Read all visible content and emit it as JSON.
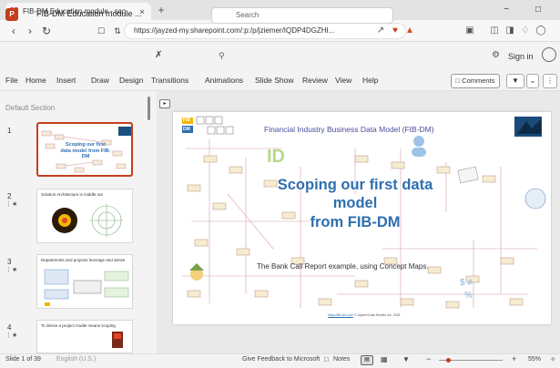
{
  "browser": {
    "tab_title": "FIB-DM Education module - sco",
    "tab_close": "×",
    "new_tab": "+",
    "minimize": "−",
    "maximize": "□",
    "url": "https://jayzed-my.sharepoint.com/:p:/p/jziemer/IQDP4DGZHI..."
  },
  "office": {
    "app_letter": "P",
    "doc_title": "FIB-DM Education module ...",
    "search_placeholder": "Search",
    "sign_in": "Sign in"
  },
  "menu": {
    "items": [
      "File",
      "Home",
      "Insert",
      "Draw",
      "Design",
      "Transitions",
      "Animations",
      "Slide Show",
      "Review",
      "View",
      "Help"
    ],
    "comments": "Comments"
  },
  "slides_panel": {
    "section": "Default Section",
    "thumbs": [
      {
        "num": "1",
        "text": "Scoping our first data model from FIB-DM"
      },
      {
        "num": "2",
        "text": "Solution Architecture is middle out"
      },
      {
        "num": "3",
        "text": "Departments and projects leverage and derive"
      },
      {
        "num": "4",
        "text": "To derive a project model means scoping"
      }
    ]
  },
  "slide": {
    "header": "Financial Industry Business Data Model (FIB-DM)",
    "id_mark": "ID",
    "title_line1": "Scoping our first data",
    "title_line2": "model",
    "title_line3": "from FIB-DM",
    "subtitle": "The Bank Call Report example, using Concept Maps.",
    "footer_link": "https://fib-dm.com",
    "footer_text": "© Jayzed Data Models Inc. 2025",
    "fib_label": "FIB",
    "dm_label": "DM",
    "symbols": "$ #",
    "percent": "%"
  },
  "status": {
    "slide_info": "Slide 1 of 39",
    "language": "English (U.S.)",
    "feedback": "Give Feedback to Microsoft",
    "notes": "Notes",
    "zoom": "55%"
  },
  "colors": {
    "accent": "#c43e1c",
    "title_blue": "#2f6fb0",
    "header_purple": "#4b4b9e"
  }
}
